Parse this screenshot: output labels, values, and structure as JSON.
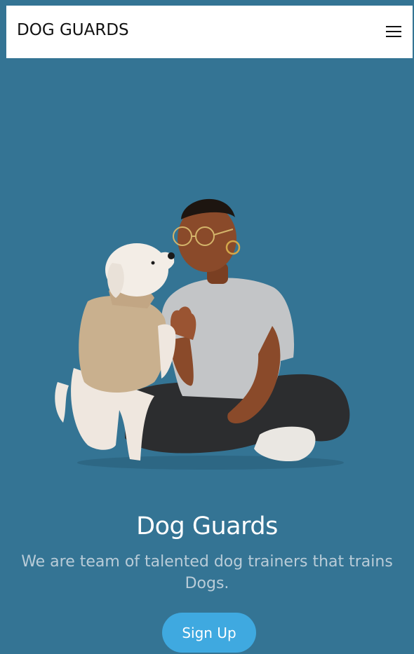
{
  "navbar": {
    "brand": "DOG GUARDS",
    "menu_icon": "hamburger-menu-icon"
  },
  "hero": {
    "illustration": "person-with-dog-illustration",
    "title": "Dog Guards",
    "subtitle": "We are team of talented dog trainers that trains Dogs.",
    "cta_label": "Sign Up"
  },
  "colors": {
    "background": "#347494",
    "navbar_background": "#ffffff",
    "title": "#ffffff",
    "subtitle": "#b9ccd8",
    "button": "#3fa9e0"
  }
}
